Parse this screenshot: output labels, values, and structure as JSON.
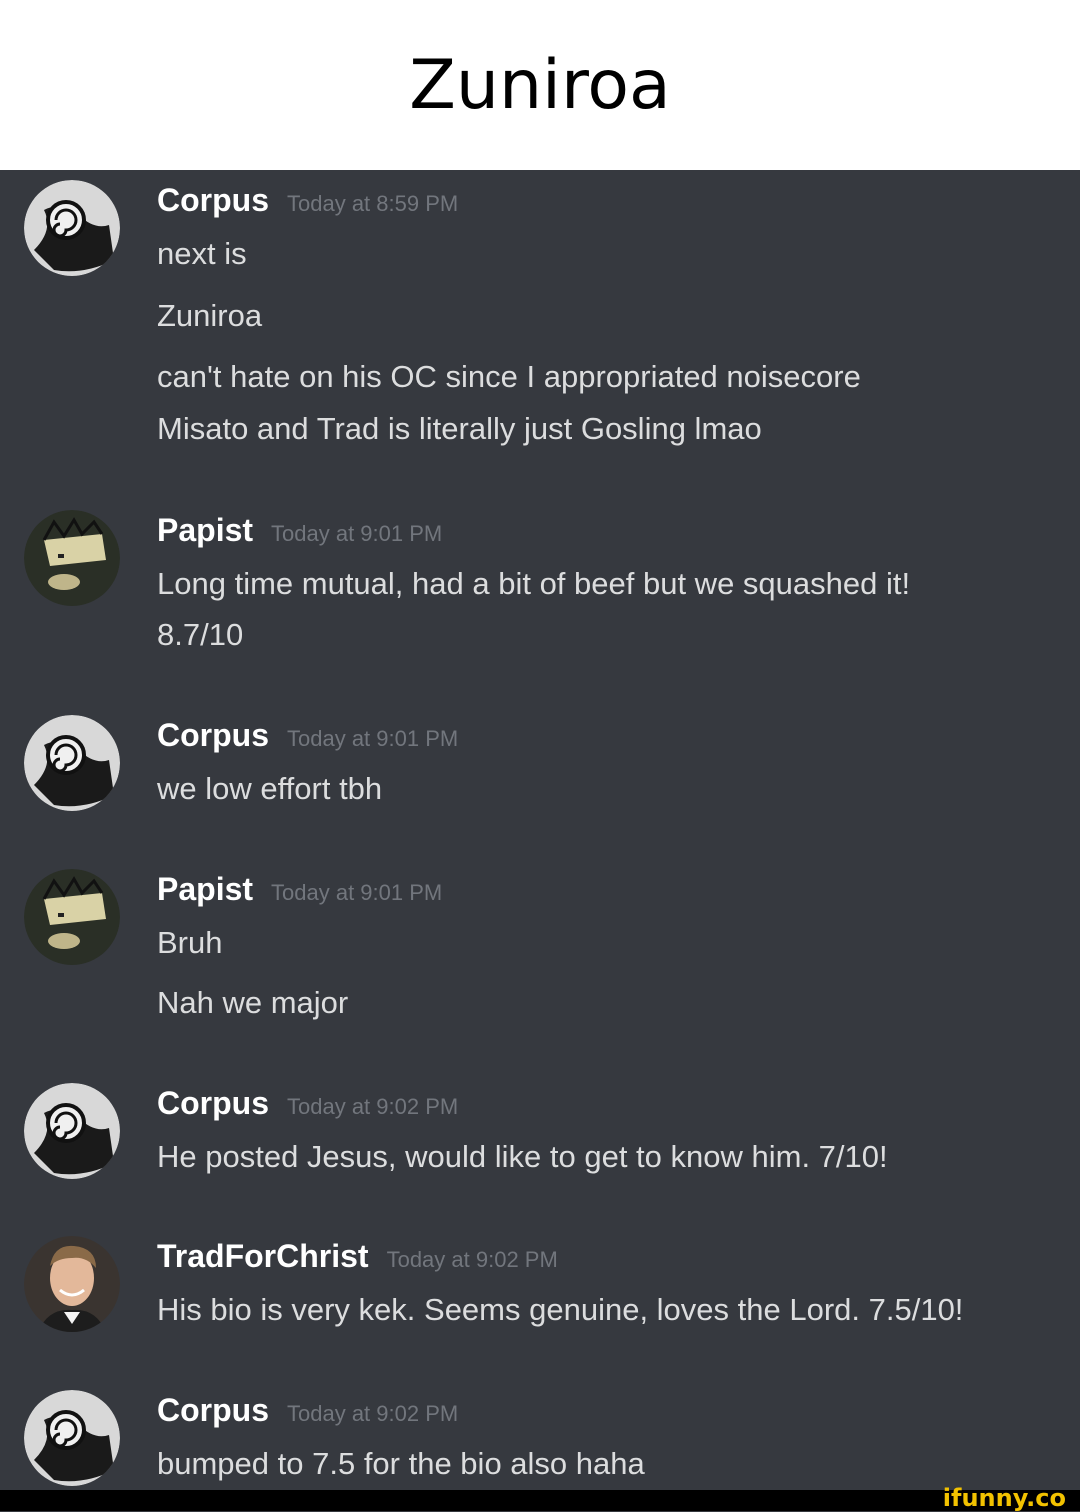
{
  "caption": "Zuniroa",
  "watermark": "ifunny.co",
  "colors": {
    "background": "#36393f",
    "username": "#ffffff",
    "text": "#dcddde",
    "timestamp": "#72767d"
  },
  "messages": [
    {
      "username": "Corpus",
      "avatar": "spiral-avatar",
      "timestamp": "Today at 8:59 PM",
      "lines": [
        "next is",
        "Zuniroa",
        "can't hate on his OC since I appropriated noisecore",
        "Misato and Trad is literally just Gosling lmao"
      ]
    },
    {
      "username": "Papist",
      "avatar": "creature-avatar",
      "timestamp": "Today at 9:01 PM",
      "lines": [
        "Long time mutual, had a bit of beef but we squashed it!",
        "8.7/10"
      ]
    },
    {
      "username": "Corpus",
      "avatar": "spiral-avatar",
      "timestamp": "Today at 9:01 PM",
      "lines": [
        "we low effort tbh"
      ]
    },
    {
      "username": "Papist",
      "avatar": "creature-avatar",
      "timestamp": "Today at 9:01 PM",
      "lines": [
        "Bruh",
        "Nah we major"
      ]
    },
    {
      "username": "Corpus",
      "avatar": "spiral-avatar",
      "timestamp": "Today at 9:02 PM",
      "lines": [
        "He posted Jesus, would like to get to know him. 7/10!"
      ]
    },
    {
      "username": "TradForChrist",
      "avatar": "photo-avatar",
      "timestamp": "Today at 9:02 PM",
      "lines": [
        "His bio is very kek. Seems genuine, loves the Lord. 7.5/10!"
      ]
    },
    {
      "username": "Corpus",
      "avatar": "spiral-avatar",
      "timestamp": "Today at 9:02 PM",
      "lines": [
        "bumped to 7.5 for the bio also haha"
      ]
    }
  ]
}
